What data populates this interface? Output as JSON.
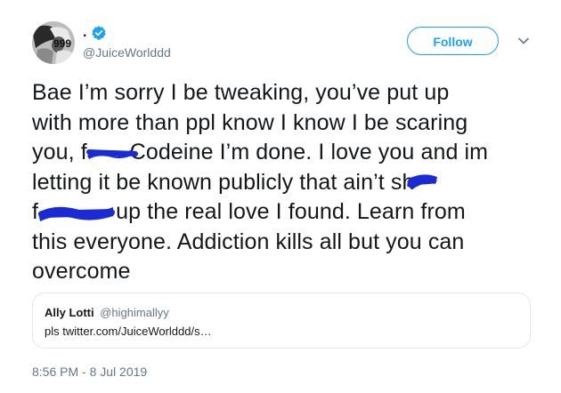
{
  "author": {
    "display_name": ".",
    "handle": "@JuiceWorlddd",
    "verified": true,
    "avatar_icon": "avatar-photo"
  },
  "follow_button": {
    "label": "Follow"
  },
  "tweet": {
    "line1": "Bae I’m sorry I be tweaking, you’ve put up",
    "line2": "with more than ppl know I know I be scaring",
    "line3_a": "you, f",
    "line3_b": "Codeine I’m done. I love you and im",
    "line4_a": "letting it be known publicly that ain’t sh",
    "line5_a": "f",
    "line5_b": " up the real love I found. Learn from",
    "line6": "this everyone. Addiction kills all but you can",
    "line7": "overcome"
  },
  "quote": {
    "name": "Ally Lotti",
    "handle": "@highimallyy",
    "text": "pls twitter.com/JuiceWorlddd/s…"
  },
  "timestamp": "8:56 PM - 8 Jul 2019",
  "colors": {
    "accent": "#1da1f2",
    "secondary_text": "#657786",
    "border": "#e1e8ed",
    "redaction": "#1a2bd6"
  }
}
